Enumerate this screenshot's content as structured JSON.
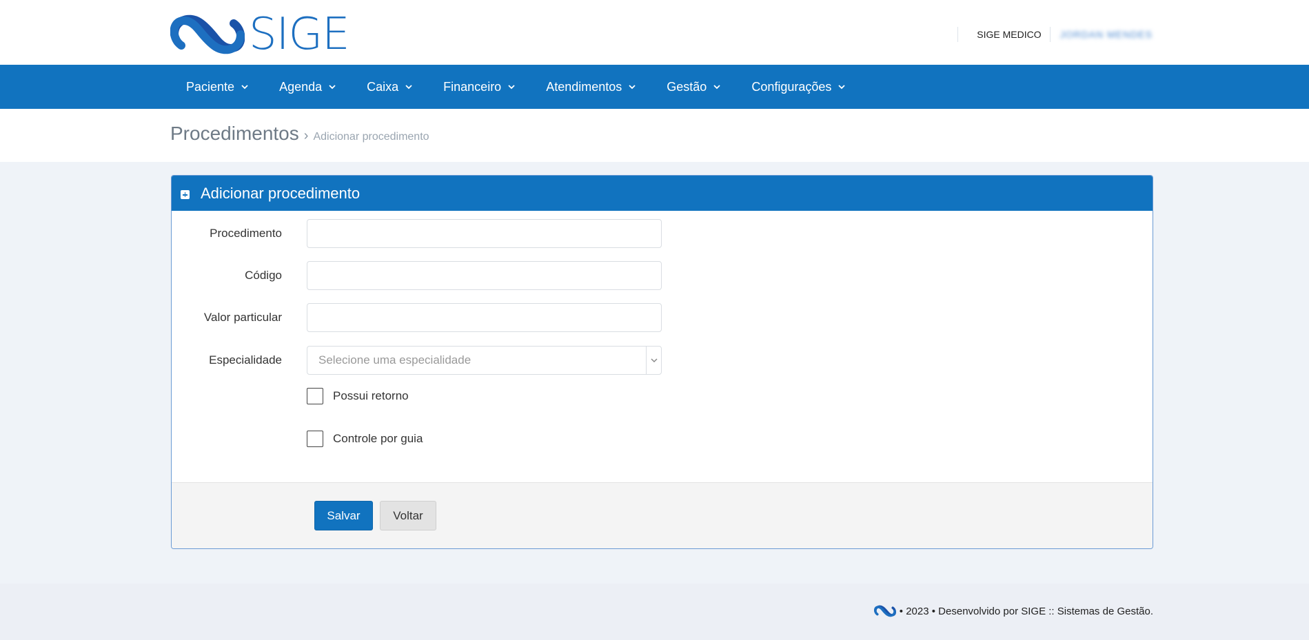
{
  "brand": {
    "name": "SIGE",
    "color": "#1d6fc0"
  },
  "topbar": {
    "clinic": "SIGE MEDICO",
    "user": "JORDAN MENDES"
  },
  "nav": {
    "items": [
      {
        "label": "Paciente"
      },
      {
        "label": "Agenda"
      },
      {
        "label": "Caixa"
      },
      {
        "label": "Financeiro"
      },
      {
        "label": "Atendimentos"
      },
      {
        "label": "Gestão"
      },
      {
        "label": "Configurações"
      }
    ]
  },
  "breadcrumb": {
    "main": "Procedimentos",
    "separator": "›",
    "current": "Adicionar procedimento"
  },
  "panel": {
    "title": "Adicionar procedimento",
    "fields": {
      "procedimento": {
        "label": "Procedimento",
        "value": ""
      },
      "codigo": {
        "label": "Código",
        "value": ""
      },
      "valor": {
        "label": "Valor particular",
        "value": ""
      },
      "especialidade": {
        "label": "Especialidade",
        "placeholder": "Selecione uma especialidade"
      }
    },
    "checks": {
      "retorno": {
        "label": "Possui retorno",
        "checked": false
      },
      "guia": {
        "label": "Controle por guia",
        "checked": false
      }
    },
    "buttons": {
      "save": "Salvar",
      "back": "Voltar"
    }
  },
  "footer": {
    "text": "• 2023 • Desenvolvido por SIGE :: Sistemas de Gestão."
  },
  "colors": {
    "primary": "#1173bf",
    "background": "#eff3f8"
  }
}
